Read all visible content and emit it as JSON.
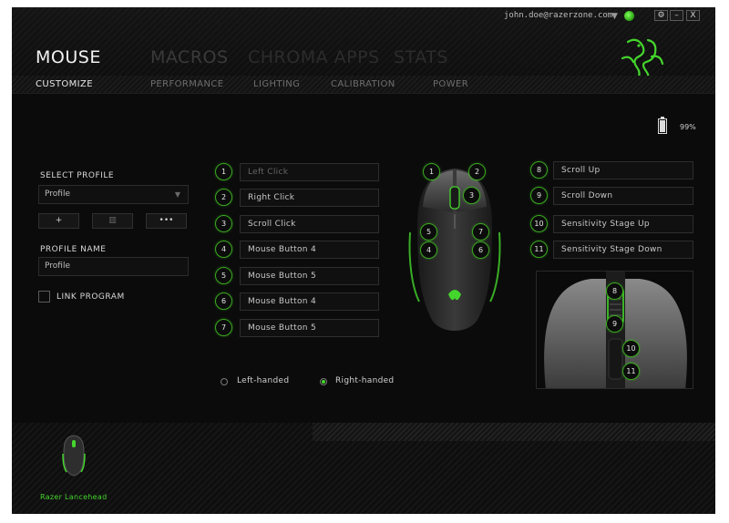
{
  "header": {
    "user_email": "john.doe@razerzone.com",
    "window_buttons": {
      "settings": "⚙",
      "minimize": "–",
      "close": "X"
    },
    "main_tabs": [
      "MOUSE",
      "MACROS",
      "CHROMA APPS",
      "STATS"
    ],
    "sub_tabs": [
      "CUSTOMIZE",
      "PERFORMANCE",
      "LIGHTING",
      "CALIBRATION",
      "POWER"
    ]
  },
  "battery": {
    "text": "99%",
    "level": 0.99
  },
  "profile": {
    "select_label": "SELECT PROFILE",
    "selected": "Profile",
    "add_label": "+",
    "delete_label": "▥",
    "more_label": "•••",
    "name_label": "PROFILE NAME",
    "name_value": "Profile",
    "link_program_label": "LINK PROGRAM"
  },
  "left_buttons": [
    {
      "num": "1",
      "label": "Left Click"
    },
    {
      "num": "2",
      "label": "Right Click"
    },
    {
      "num": "3",
      "label": "Scroll Click"
    },
    {
      "num": "4",
      "label": "Mouse Button 4"
    },
    {
      "num": "5",
      "label": "Mouse Button 5"
    },
    {
      "num": "6",
      "label": "Mouse Button 4"
    },
    {
      "num": "7",
      "label": "Mouse Button 5"
    }
  ],
  "right_buttons": [
    {
      "num": "8",
      "label": "Scroll Up"
    },
    {
      "num": "9",
      "label": "Scroll Down"
    },
    {
      "num": "10",
      "label": "Sensitivity Stage Up"
    },
    {
      "num": "11",
      "label": "Sensitivity Stage Down"
    }
  ],
  "mouse_markers": [
    "1",
    "2",
    "3",
    "5",
    "7",
    "4",
    "6"
  ],
  "zoom_markers": [
    "8",
    "9",
    "10",
    "11"
  ],
  "handedness": {
    "left": "Left-handed",
    "right": "Right-handed",
    "selected": "right"
  },
  "device": {
    "name": "Razer Lancehead"
  },
  "colors": {
    "accent": "#44d62c",
    "background": "#0b0b0b"
  }
}
